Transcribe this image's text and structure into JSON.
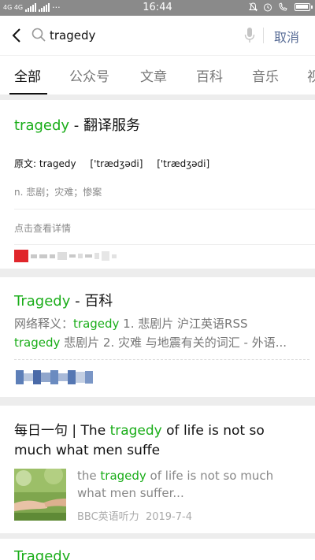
{
  "status_bar": {
    "network": "4G 4G",
    "time": "16:44",
    "more": "···"
  },
  "search": {
    "query": "tragedy",
    "cancel_label": "取消"
  },
  "tabs": [
    {
      "label": "全部",
      "active": true
    },
    {
      "label": "公众号"
    },
    {
      "label": "文章"
    },
    {
      "label": "百科"
    },
    {
      "label": "音乐"
    },
    {
      "label": "视"
    }
  ],
  "translation_card": {
    "keyword": "tragedy",
    "separator": " - ",
    "service": "翻译服务",
    "original_label": "原文: tragedy",
    "phonetic_uk": "['trædʒədi]",
    "phonetic_us": "['trædʒədi]",
    "definition": "n. 悲剧；灾难；惨案",
    "more_link": "点击查看详情"
  },
  "baike_card": {
    "keyword": "Tragedy",
    "separator": " - ",
    "suffix": "百科",
    "line1_prefix": "网络释义：",
    "line1_keyword": "tragedy",
    "line1_rest": " 1. 悲剧片 沪江英语RSS",
    "line2_keyword": "tragedy",
    "line2_rest": " 悲剧片 2. 灾难 与地震有关的词汇 - 外语..."
  },
  "article_card": {
    "title_prefix": "每日一句 | The ",
    "title_keyword": "tragedy",
    "title_rest": " of life is not so much what men suffe",
    "snippet_prefix": "the ",
    "snippet_keyword": "tragedy",
    "snippet_rest": " of life is not so much what men suffer...",
    "source": "BBC英语听力",
    "date": "2019-7-4"
  },
  "next_card": {
    "title": "Tragedy"
  },
  "colors": {
    "keyword_green": "#1aad19",
    "link_blue": "#576b95",
    "status_bar": "#8a8a8a"
  }
}
